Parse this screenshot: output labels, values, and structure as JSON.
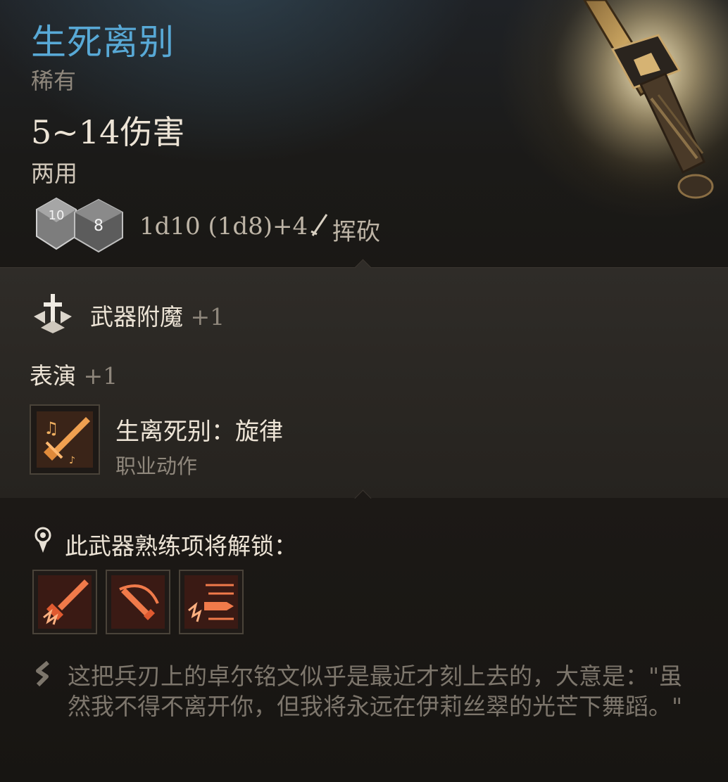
{
  "item": {
    "name": "生死离别",
    "rarity": "稀有",
    "damage": "5~14伤害",
    "handedness": "两用",
    "dice": {
      "die1_face": "10",
      "die2_face": "8",
      "formula": "1d10 (1d8)+4",
      "damage_type": "挥砍"
    }
  },
  "enchantment": {
    "label": "武器附魔",
    "bonus": "+1"
  },
  "performance": {
    "label": "表演",
    "bonus": "+1"
  },
  "action": {
    "name": "生离死别：旋律",
    "type": "职业动作"
  },
  "proficiency": {
    "label": "此武器熟练项将解锁："
  },
  "description": "这把兵刃上的卓尔铭文似乎是最近才刻上去的，大意是：\"虽然我不得不离开你，但我将永远在伊莉丝翠的光芒下舞蹈。\"",
  "colors": {
    "title": "#58a9d6",
    "muted": "#8f877c",
    "text": "#ede4d6",
    "skill_glow": "#e07a3a"
  }
}
